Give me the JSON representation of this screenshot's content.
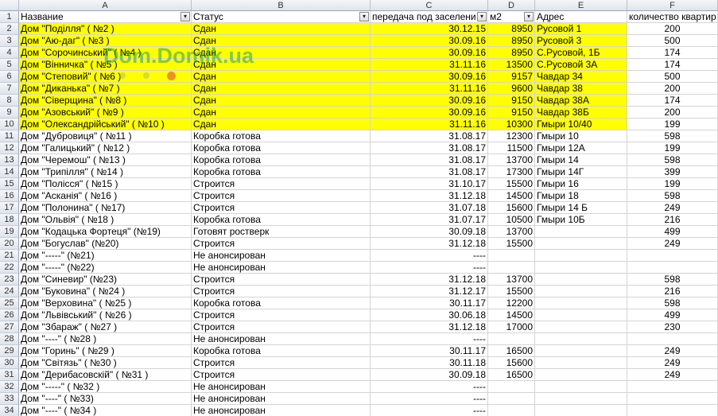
{
  "columns": [
    "A",
    "B",
    "C",
    "D",
    "E",
    "F"
  ],
  "header_row": {
    "num": "1",
    "name": "Название",
    "status": "Статус",
    "date": "передача под заселени",
    "area": "м2",
    "address": "Адрес",
    "flats": "количество квартир"
  },
  "filter_icon": "▾",
  "watermark": "Dom.Domik.ua",
  "rows": [
    {
      "n": "2",
      "name": "Дом \"Поділля\" ( №2 )",
      "status": "Сдан",
      "date": "30.12.15",
      "area": "8950",
      "addr": "Русовой 1",
      "flats": "200",
      "hl": true
    },
    {
      "n": "3",
      "name": "Дом \"Аю-даг\" ( №3 )",
      "status": "Сдан",
      "date": "30.09.16",
      "area": "8950",
      "addr": "Русовой 3",
      "flats": "500",
      "hl": true
    },
    {
      "n": "4",
      "name": "Дом \"Сорочинський\" ( №4 )",
      "status": "Сдан",
      "date": "30.09.16",
      "area": "8950",
      "addr": "С.Русовой, 1Б",
      "flats": "174",
      "hl": true
    },
    {
      "n": "5",
      "name": "Дом \"Вінничка\" ( №5 )",
      "status": "Сдан",
      "date": "31.11.16",
      "area": "13500",
      "addr": "С.Русовой 3А",
      "flats": "174",
      "hl": true
    },
    {
      "n": "6",
      "name": "Дом \"Степовий\" ( №6 )",
      "status": "Сдан",
      "date": "30.09.16",
      "area": "9157",
      "addr": "Чавдар 34",
      "flats": "500",
      "hl": true
    },
    {
      "n": "7",
      "name": "Дом \"Диканька\" ( №7 )",
      "status": "Сдан",
      "date": "31.11.16",
      "area": "9600",
      "addr": "Чавдар 38",
      "flats": "200",
      "hl": true
    },
    {
      "n": "8",
      "name": "Дом \"Сіверщина\" ( №8 )",
      "status": "Сдан",
      "date": "30.09.16",
      "area": "9150",
      "addr": "Чавдар 38А",
      "flats": "174",
      "hl": true
    },
    {
      "n": "9",
      "name": "Дом \"Азовський\" ( №9 )",
      "status": "Сдан",
      "date": "30.09.16",
      "area": "9150",
      "addr": "Чавдар 38Б",
      "flats": "200",
      "hl": true
    },
    {
      "n": "10",
      "name": "Дом \"Олександрійський\" ( №10 )",
      "status": "Сдан",
      "date": "31.11.16",
      "area": "10300",
      "addr": "Гмыри 10/40",
      "flats": "199",
      "hl": true
    },
    {
      "n": "11",
      "name": "Дом \"Дубровиця\" ( №11 )",
      "status": "Коробка готова",
      "date": "31.08.17",
      "area": "12300",
      "addr": "Гмыри 10",
      "flats": "598",
      "hl": false
    },
    {
      "n": "12",
      "name": "Дом \"Галицький\" ( №12 )",
      "status": "Коробка готова",
      "date": "31.08.17",
      "area": "11500",
      "addr": "Гмыри 12А",
      "flats": "199",
      "hl": false
    },
    {
      "n": "13",
      "name": "Дом \"Черемош\" ( №13 )",
      "status": "Коробка готова",
      "date": "31.08.17",
      "area": "13700",
      "addr": "Гмыри 14",
      "flats": "598",
      "hl": false
    },
    {
      "n": "14",
      "name": "Дом \"Трипілля\" ( №14 )",
      "status": "Коробка готова",
      "date": "31.08.17",
      "area": "17300",
      "addr": "Гмыри 14Г",
      "flats": "399",
      "hl": false
    },
    {
      "n": "15",
      "name": "Дом \"Полісся\" ( №15 )",
      "status": "Строится",
      "date": "31.10.17",
      "area": "15500",
      "addr": "Гмыри 16",
      "flats": "199",
      "hl": false
    },
    {
      "n": "16",
      "name": "Дом \"Асканія\" ( №16 )",
      "status": "Строится",
      "date": "31.12.18",
      "area": "14500",
      "addr": "Гмыри 18",
      "flats": "598",
      "hl": false
    },
    {
      "n": "17",
      "name": "Дом \"Полонина\" ( №17)",
      "status": "Строится",
      "date": "31.07.18",
      "area": "15600",
      "addr": "Гмыри 14 Б",
      "flats": "249",
      "hl": false
    },
    {
      "n": "18",
      "name": "Дом \"Ольвія\" ( №18 )",
      "status": "Коробка готова",
      "date": "31.07.17",
      "area": "10500",
      "addr": "Гмыри 10Б",
      "flats": "216",
      "hl": false
    },
    {
      "n": "19",
      "name": "Дом \"Кодацька Фортеця\" (№19)",
      "status": "Готовят ростверк",
      "date": "30.09.18",
      "area": "13700",
      "addr": "",
      "flats": "499",
      "hl": false
    },
    {
      "n": "20",
      "name": "Дом \"Богуслав\" (№20)",
      "status": "Строится",
      "date": "31.12.18",
      "area": "15500",
      "addr": "",
      "flats": "249",
      "hl": false
    },
    {
      "n": "21",
      "name": "Дом \"-----\" (№21)",
      "status": "Не анонсирован",
      "date": "----",
      "area": "",
      "addr": "",
      "flats": "",
      "hl": false
    },
    {
      "n": "22",
      "name": "Дом \"-----\" (№22)",
      "status": "Не анонсирован",
      "date": "----",
      "area": "",
      "addr": "",
      "flats": "",
      "hl": false
    },
    {
      "n": "23",
      "name": "Дом \"Синевир\" (№23)",
      "status": "Строится",
      "date": "31.12.18",
      "area": "13700",
      "addr": "",
      "flats": "598",
      "hl": false
    },
    {
      "n": "24",
      "name": "Дом \"Буковина\" ( №24 )",
      "status": "Строится",
      "date": "31.12.17",
      "area": "15500",
      "addr": "",
      "flats": "216",
      "hl": false
    },
    {
      "n": "25",
      "name": "Дом \"Верховина\" ( №25 )",
      "status": "Коробка готова",
      "date": "30.11.17",
      "area": "12200",
      "addr": "",
      "flats": "598",
      "hl": false
    },
    {
      "n": "26",
      "name": "Дом \"Львівський\" ( №26 )",
      "status": "Строится",
      "date": "30.06.18",
      "area": "14500",
      "addr": "",
      "flats": "499",
      "hl": false
    },
    {
      "n": "27",
      "name": "Дом \"Збараж\" ( №27 )",
      "status": "Строится",
      "date": "31.12.18",
      "area": "17000",
      "addr": "",
      "flats": "230",
      "hl": false
    },
    {
      "n": "28",
      "name": "Дом \"----\" ( №28 )",
      "status": "Не анонсирован",
      "date": "----",
      "area": "",
      "addr": "",
      "flats": "",
      "hl": false
    },
    {
      "n": "29",
      "name": "Дом \"Горинь\" ( №29 )",
      "status": "Коробка готова",
      "date": "30.11.17",
      "area": "16500",
      "addr": "",
      "flats": "249",
      "hl": false
    },
    {
      "n": "30",
      "name": "Дом \"Світязь\" ( №30 )",
      "status": "Строится",
      "date": "30.11.18",
      "area": "15600",
      "addr": "",
      "flats": "249",
      "hl": false
    },
    {
      "n": "31",
      "name": "Дом \"Дерибасовскій\" ( №31 )",
      "status": "Строится",
      "date": "30.09.18",
      "area": "16500",
      "addr": "",
      "flats": "249",
      "hl": false
    },
    {
      "n": "32",
      "name": "Дом \"-----\" ( №32 )",
      "status": "Не анонсирован",
      "date": "----",
      "area": "",
      "addr": "",
      "flats": "",
      "hl": false
    },
    {
      "n": "33",
      "name": "Дом \"----\" ( №33)",
      "status": "Не анонсирован",
      "date": "----",
      "area": "",
      "addr": "",
      "flats": "",
      "hl": false
    },
    {
      "n": "34",
      "name": "Дом \"----\"  ( №34 )",
      "status": "Не анонсирован",
      "date": "----",
      "area": "",
      "addr": "",
      "flats": "",
      "hl": false
    }
  ],
  "colors": {
    "highlight": "#ffff00",
    "grid": "#d4d4d4",
    "header_bg": "#dfe4ec"
  }
}
